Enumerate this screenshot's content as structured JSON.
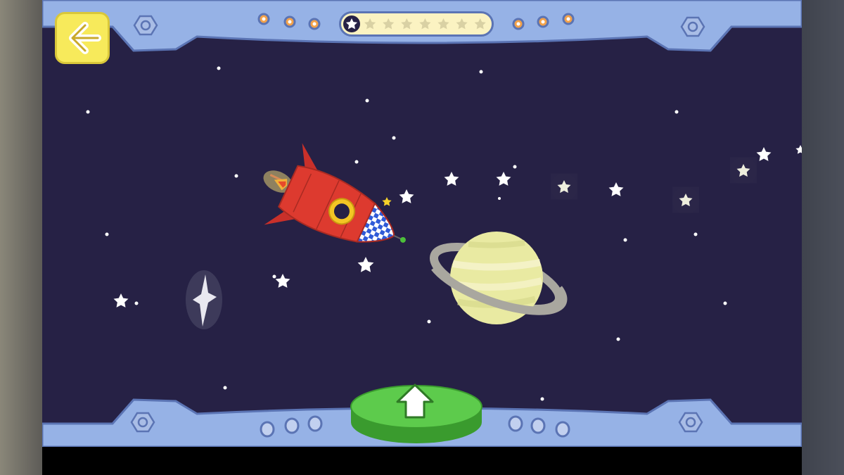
{
  "game": {
    "scene": "space",
    "progress": {
      "stars_total": 8,
      "stars_earned": 1
    },
    "controls": {
      "back_button": {
        "icon": "arrow-left-icon"
      },
      "launch_button": {
        "icon": "arrow-up-icon"
      }
    }
  },
  "colors": {
    "space": "#262145",
    "frame": "#96b2e6",
    "frame_dark": "#5b74b4",
    "back_button": "#f7ea5b",
    "launch_button": "#5dcb4c",
    "rocket": "#dd3a2f",
    "planet": "#e9eaa2",
    "ring": "#a9a79f"
  }
}
